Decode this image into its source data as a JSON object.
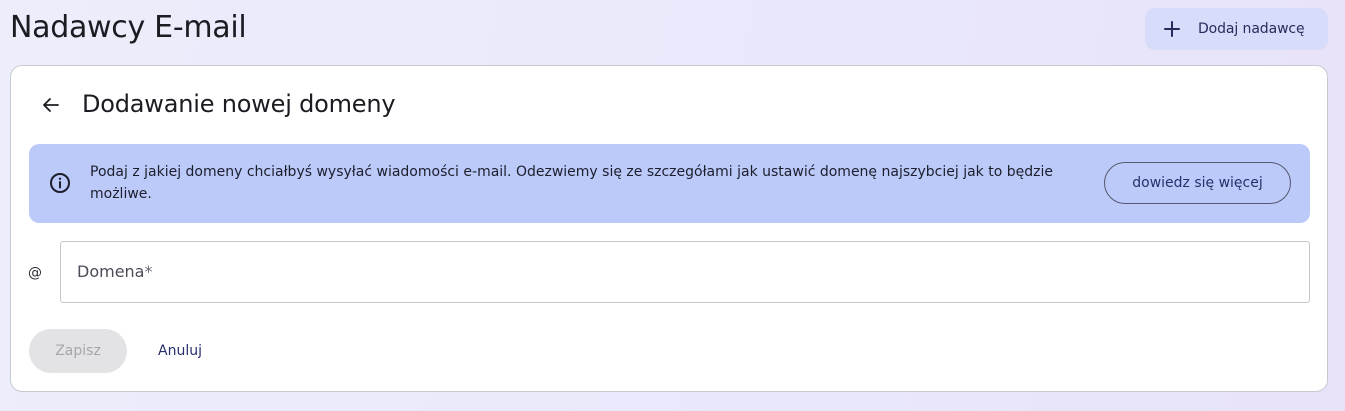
{
  "header": {
    "title": "Nadawcy E-mail",
    "add_button_label": "Dodaj nadawcę",
    "add_button_icon": "plus-icon"
  },
  "card": {
    "back_icon": "arrow-left-icon",
    "title": "Dodawanie nowej domeny",
    "info_banner": {
      "icon": "info-icon",
      "text": "Podaj z jakiej domeny chciałbyś wysyłać wiadomości e-mail. Odezwiemy się ze szczegółami jak ustawić domenę najszybciej jak to będzie możliwe.",
      "button_label": "dowiedz się więcej"
    },
    "domain_field": {
      "prefix_icon": "at-icon",
      "prefix_glyph": "@",
      "label": "Domena",
      "required_mark": "*",
      "value": ""
    },
    "actions": {
      "save_label": "Zapisz",
      "save_state": "disabled",
      "cancel_label": "Anuluj"
    }
  },
  "colors": {
    "background": "#eceefb",
    "primary_button_bg": "#d7dcfa",
    "info_banner_bg": "#bccafa",
    "accent_text": "#27306a",
    "disabled_button_bg": "#e3e3e6",
    "disabled_button_text": "#a5a6ab"
  }
}
